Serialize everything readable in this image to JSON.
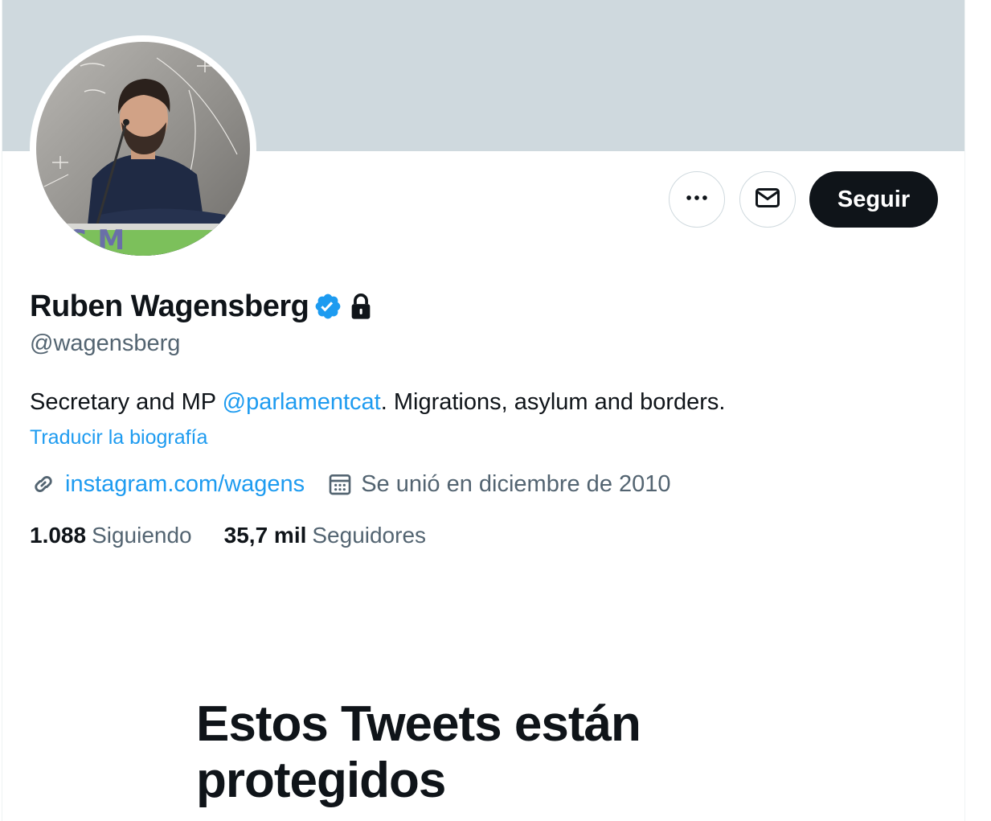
{
  "profile": {
    "display_name": "Ruben Wagensberg",
    "handle": "@wagensberg",
    "bio_prefix": "Secretary and MP ",
    "bio_mention": "@parlamentcat",
    "bio_suffix": ". Migrations, asylum and borders.",
    "translate_label": "Traducir la biografía",
    "website": "instagram.com/wagens",
    "joined": "Se unió en diciembre de 2010",
    "verified": true,
    "protected": true
  },
  "actions": {
    "more_icon": "more-horizontal-icon",
    "message_icon": "envelope-icon",
    "follow_label": "Seguir"
  },
  "stats": {
    "following_count": "1.088",
    "following_label": "Siguiendo",
    "followers_count": "35,7 mil",
    "followers_label": "Seguidores"
  },
  "protected_notice": {
    "title": "Estos Tweets están protegidos"
  },
  "colors": {
    "banner": "#cfd9de",
    "accent": "#1d9bf0",
    "primary_text": "#0f1419",
    "secondary_text": "#536471",
    "follow_button": "#0f1419"
  }
}
